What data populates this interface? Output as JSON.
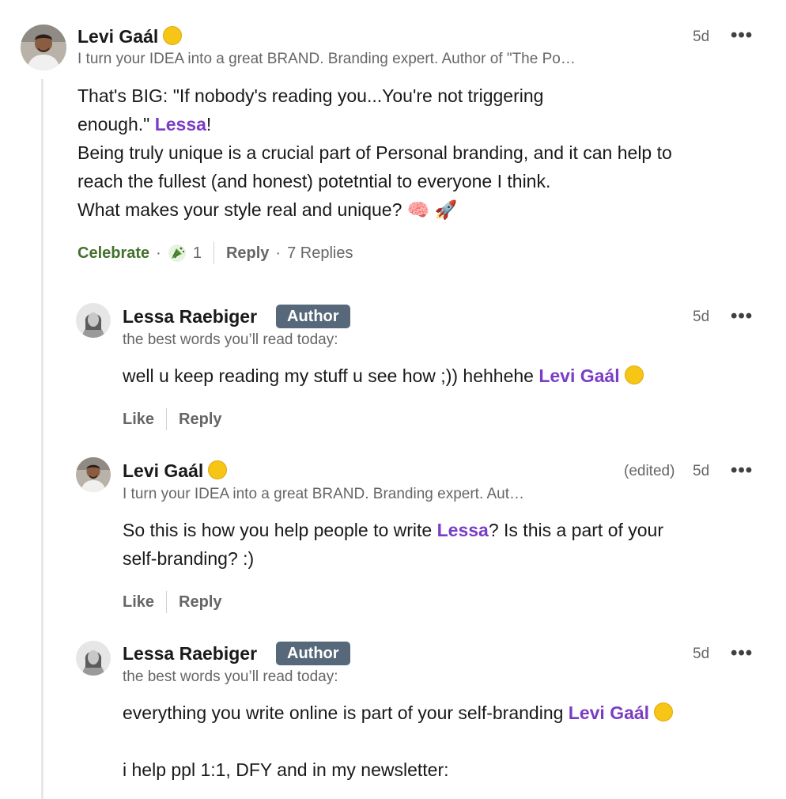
{
  "comments": [
    {
      "author": "Levi Gaál",
      "headline": "I turn your IDEA into a great BRAND. Branding expert. Author of \"The Po…",
      "time": "5d",
      "edited": "",
      "more": "•••",
      "lines": [
        "That's BIG: \"If nobody's reading you...You're not triggering",
        "enough.\" ",
        "!",
        "Being truly unique is a crucial part of Personal branding, and it can help to",
        "reach the fullest (and honest) potetntial to everyone I think.",
        "What makes your style real and unique? 🧠 🚀"
      ],
      "mention": "Lessa",
      "actions": {
        "celebrate": "Celebrate",
        "reaction_count": "1",
        "reply": "Reply",
        "replies": "7 Replies",
        "dot": "·"
      }
    },
    {
      "author": "Lessa Raebiger",
      "badge": "Author",
      "headline": "the best words you’ll read today:",
      "time": "5d",
      "more": "•••",
      "text_before": "well u keep reading my stuff u see how ;)) hehhehe ",
      "mention": "Levi Gaál",
      "actions": {
        "like": "Like",
        "reply": "Reply"
      }
    },
    {
      "author": "Levi Gaál",
      "headline": "I turn your IDEA into a great BRAND. Branding expert. Aut…",
      "edited": "(edited)",
      "time": "5d",
      "more": "•••",
      "text_before": "So this is how you help people to write ",
      "mention": "Lessa",
      "text_after": "? Is this a part of your",
      "line2": "self-branding? :)",
      "actions": {
        "like": "Like",
        "reply": "Reply"
      }
    },
    {
      "author": "Lessa Raebiger",
      "badge": "Author",
      "headline": "the best words you’ll read today:",
      "time": "5d",
      "more": "•••",
      "text_before": "everything you write online is part of your self-branding ",
      "mention": "Levi Gaál",
      "line3": "i help ppl 1:1, DFY and in my newsletter:"
    }
  ],
  "colors": {
    "mention": "#7b3cc6",
    "celebrate": "#44712e",
    "badge_bg": "#56687a",
    "secondary_text": "#666666"
  }
}
